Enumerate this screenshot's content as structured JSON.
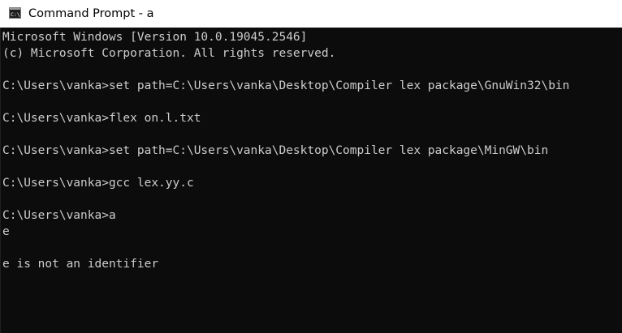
{
  "window": {
    "title": "Command Prompt - a",
    "icon": "cmd-icon"
  },
  "console": {
    "lines": [
      "Microsoft Windows [Version 10.0.19045.2546]",
      "(c) Microsoft Corporation. All rights reserved.",
      "",
      "C:\\Users\\vanka>set path=C:\\Users\\vanka\\Desktop\\Compiler lex package\\GnuWin32\\bin",
      "",
      "C:\\Users\\vanka>flex on.l.txt",
      "",
      "C:\\Users\\vanka>set path=C:\\Users\\vanka\\Desktop\\Compiler lex package\\MinGW\\bin",
      "",
      "C:\\Users\\vanka>gcc lex.yy.c",
      "",
      "C:\\Users\\vanka>a",
      "e",
      "",
      "e is not an identifier"
    ]
  },
  "colors": {
    "background": "#0c0c0c",
    "text": "#cccccc",
    "titlebar": "#ffffff"
  }
}
